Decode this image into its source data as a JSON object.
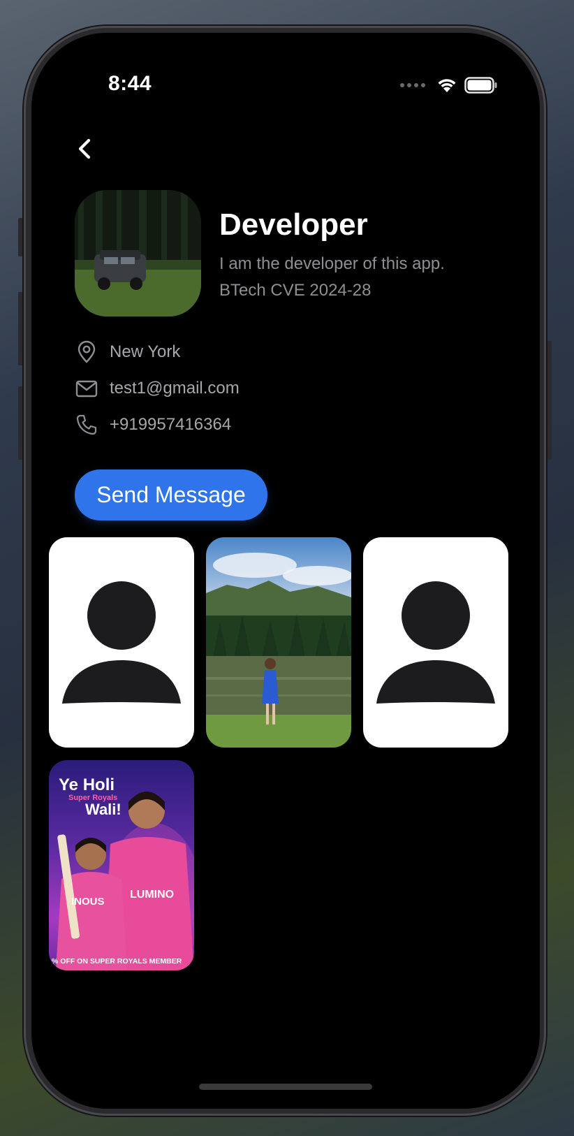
{
  "status_bar": {
    "time": "8:44"
  },
  "profile": {
    "name": "Developer",
    "bio_line1": "I am the developer of this app.",
    "bio_line2": "BTech CVE 2024-28",
    "location": "New York",
    "email": "test1@gmail.com",
    "phone": "+919957416364"
  },
  "actions": {
    "send_message_label": "Send Message"
  },
  "gallery": {
    "tiles": [
      {
        "type": "placeholder",
        "icon": "person-placeholder-icon"
      },
      {
        "type": "photo",
        "subject": "woman by lake"
      },
      {
        "type": "placeholder",
        "icon": "person-placeholder-icon"
      },
      {
        "type": "poster"
      }
    ],
    "poster": {
      "title_line1": "Ye Holi",
      "title_sub": "Super Royals",
      "title_line2": "Wali!",
      "jersey_left": "INOUS",
      "jersey_right": "LUMINO",
      "footer": "% OFF ON SUPER ROYALS MEMBER"
    }
  },
  "colors": {
    "accent": "#2f74ea",
    "background": "#000000",
    "secondary_text": "#8e8e93"
  }
}
